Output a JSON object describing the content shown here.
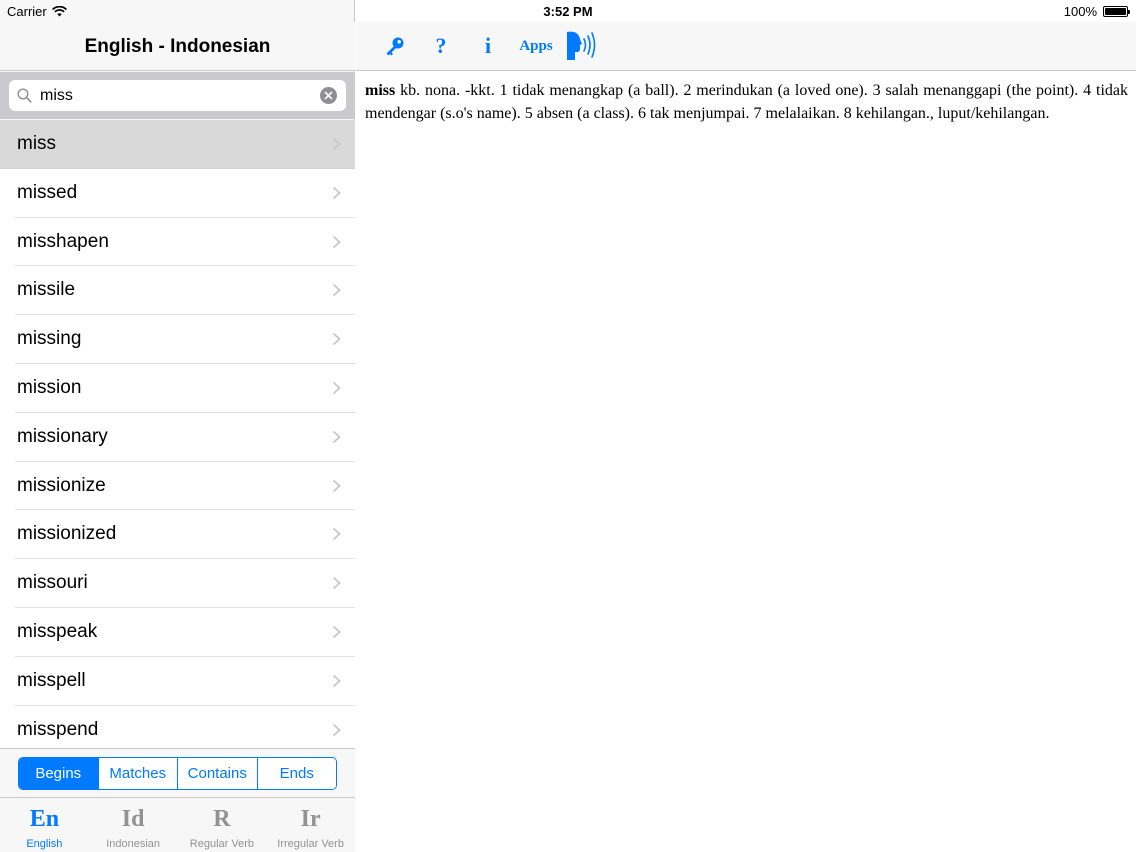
{
  "status_bar": {
    "carrier": "Carrier",
    "time": "3:52 PM",
    "battery_text": "100%",
    "battery_level_percent": 100
  },
  "master": {
    "title": "English - Indonesian",
    "search": {
      "value": "miss",
      "placeholder": "Search"
    },
    "words": [
      {
        "label": "miss",
        "selected": true
      },
      {
        "label": "missed"
      },
      {
        "label": "misshapen"
      },
      {
        "label": "missile"
      },
      {
        "label": "missing"
      },
      {
        "label": "mission"
      },
      {
        "label": "missionary"
      },
      {
        "label": "missionize"
      },
      {
        "label": "missionized"
      },
      {
        "label": "missouri"
      },
      {
        "label": "misspeak"
      },
      {
        "label": "misspell"
      },
      {
        "label": "misspend"
      }
    ],
    "segments": [
      {
        "label": "Begins",
        "active": true
      },
      {
        "label": "Matches"
      },
      {
        "label": "Contains"
      },
      {
        "label": "Ends"
      }
    ],
    "tabs": [
      {
        "glyph": "En",
        "label": "English",
        "active": true
      },
      {
        "glyph": "Id",
        "label": "Indonesian"
      },
      {
        "glyph": "R",
        "label": "Regular Verb"
      },
      {
        "glyph": "Ir",
        "label": "Irregular Verb"
      }
    ]
  },
  "toolbar": {
    "key_icon": "key-icon",
    "help_label": "?",
    "info_label": "i",
    "apps_label": "Apps",
    "speak_icon": "speaker-head-icon"
  },
  "definition": {
    "headword": "miss",
    "text": "kb. nona. -kkt. 1 tidak menangkap (a ball). 2 merindukan (a loved one). 3 salah menanggapi (the point). 4 tidak mendengar (s.o's name). 5 absen (a class). 6 tak menjumpai. 7 melalaikan. 8 kehilangan., luput/kehilangan."
  },
  "colors": {
    "accent": "#007aff",
    "selected_row": "#d9d9d9",
    "inactive_tab": "#929292"
  }
}
